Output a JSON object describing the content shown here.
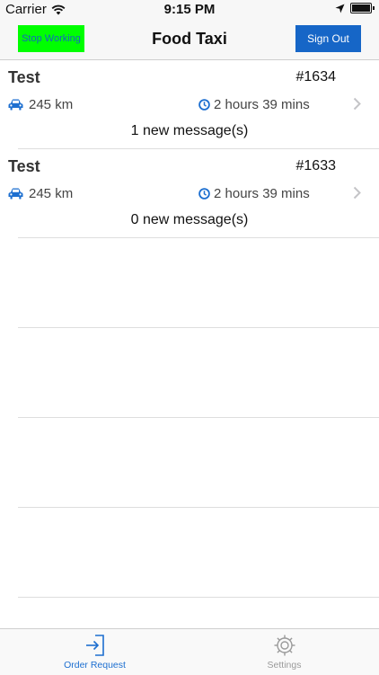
{
  "status_bar": {
    "carrier": "Carrier",
    "time": "9:15 PM",
    "icons": [
      "wifi-icon",
      "location-arrow-icon",
      "battery-icon"
    ]
  },
  "nav": {
    "title": "Food Taxi",
    "left_button": "Stop Working",
    "right_button": "Sign Out"
  },
  "orders": [
    {
      "name": "Test",
      "id": "#1634",
      "distance": "245 km",
      "eta": "2 hours 39 mins",
      "messages": "1 new message(s)"
    },
    {
      "name": "Test",
      "id": "#1633",
      "distance": "245 km",
      "eta": "2 hours 39 mins",
      "messages": "0 new message(s)"
    }
  ],
  "tabs": [
    {
      "label": "Order Request",
      "icon": "sign-in-icon",
      "selected": true
    },
    {
      "label": "Settings",
      "icon": "gear-icon",
      "selected": false
    }
  ],
  "colors": {
    "stop_button_bg": "#00ff00",
    "sign_out_bg": "#1666c7",
    "accent_blue": "#1d6fd0"
  }
}
